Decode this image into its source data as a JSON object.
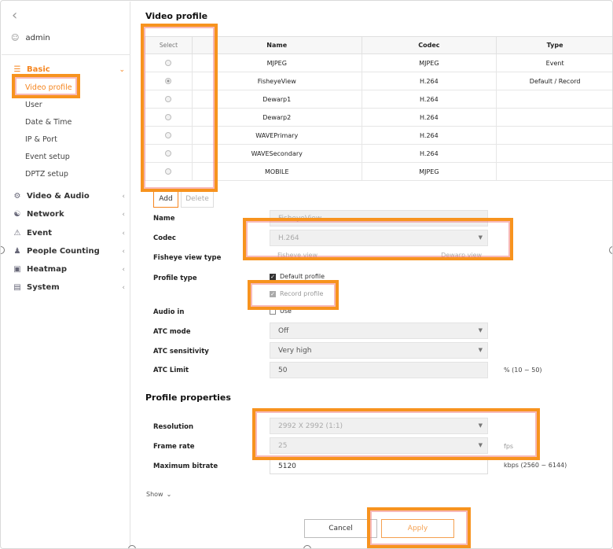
{
  "sidebar": {
    "back_glyph": "‹",
    "user_icon": "person-icon",
    "user_name": "admin",
    "basic": {
      "label": "Basic",
      "icon": "list-icon",
      "chevron": "⌄"
    },
    "basic_items": [
      "Video profile",
      "User",
      "Date & Time",
      "IP & Port",
      "Event setup",
      "DPTZ setup"
    ],
    "menus": [
      {
        "label": "Video & Audio",
        "icon": "sliders-icon"
      },
      {
        "label": "Network",
        "icon": "network-icon"
      },
      {
        "label": "Event",
        "icon": "alarm-icon"
      },
      {
        "label": "People Counting",
        "icon": "people-icon"
      },
      {
        "label": "Heatmap",
        "icon": "heatmap-icon"
      },
      {
        "label": "System",
        "icon": "system-icon"
      }
    ],
    "collapsed_chevron": "‹"
  },
  "video_profile": {
    "title": "Video profile",
    "columns": [
      "Select",
      "Name",
      "Codec",
      "Type"
    ],
    "rows": [
      {
        "name": "MJPEG",
        "codec": "MJPEG",
        "type": "Event",
        "selected": false
      },
      {
        "name": "FisheyeView",
        "codec": "H.264",
        "type": "Default / Record",
        "selected": true
      },
      {
        "name": "Dewarp1",
        "codec": "H.264",
        "type": "",
        "selected": false
      },
      {
        "name": "Dewarp2",
        "codec": "H.264",
        "type": "",
        "selected": false
      },
      {
        "name": "WAVEPrimary",
        "codec": "H.264",
        "type": "",
        "selected": false
      },
      {
        "name": "WAVESecondary",
        "codec": "H.264",
        "type": "",
        "selected": false
      },
      {
        "name": "MOBILE",
        "codec": "MJPEG",
        "type": "",
        "selected": false
      }
    ],
    "add_label": "Add",
    "delete_label": "Delete"
  },
  "form": {
    "name_label": "Name",
    "name_value": "FisheyeView",
    "codec_label": "Codec",
    "codec_value": "H.264",
    "fisheye_label": "Fisheye view type",
    "fisheye_opt1": "Fisheye view",
    "fisheye_opt2": "Dewarp view",
    "profile_type_label": "Profile type",
    "default_profile": "Default profile",
    "record_profile": "Record profile",
    "audio_label": "Audio in",
    "audio_use": "Use",
    "atc_mode_label": "ATC mode",
    "atc_mode_value": "Off",
    "atc_sens_label": "ATC sensitivity",
    "atc_sens_value": "Very high",
    "atc_limit_label": "ATC Limit",
    "atc_limit_value": "50",
    "atc_limit_unit": "% (10 ~ 50)"
  },
  "properties": {
    "title": "Profile properties",
    "resolution_label": "Resolution",
    "resolution_value": "2992 X 2992 (1:1)",
    "frame_rate_label": "Frame rate",
    "frame_rate_value": "25",
    "frame_rate_unit": "fps",
    "bitrate_label": "Maximum bitrate",
    "bitrate_value": "5120",
    "bitrate_unit": "kbps (2560 ~ 6144)",
    "show_label": "Show",
    "show_chevron": "⌄"
  },
  "actions": {
    "cancel": "Cancel",
    "apply": "Apply"
  },
  "colors": {
    "accent": "#f5851f",
    "highlight": "#f7931e"
  }
}
